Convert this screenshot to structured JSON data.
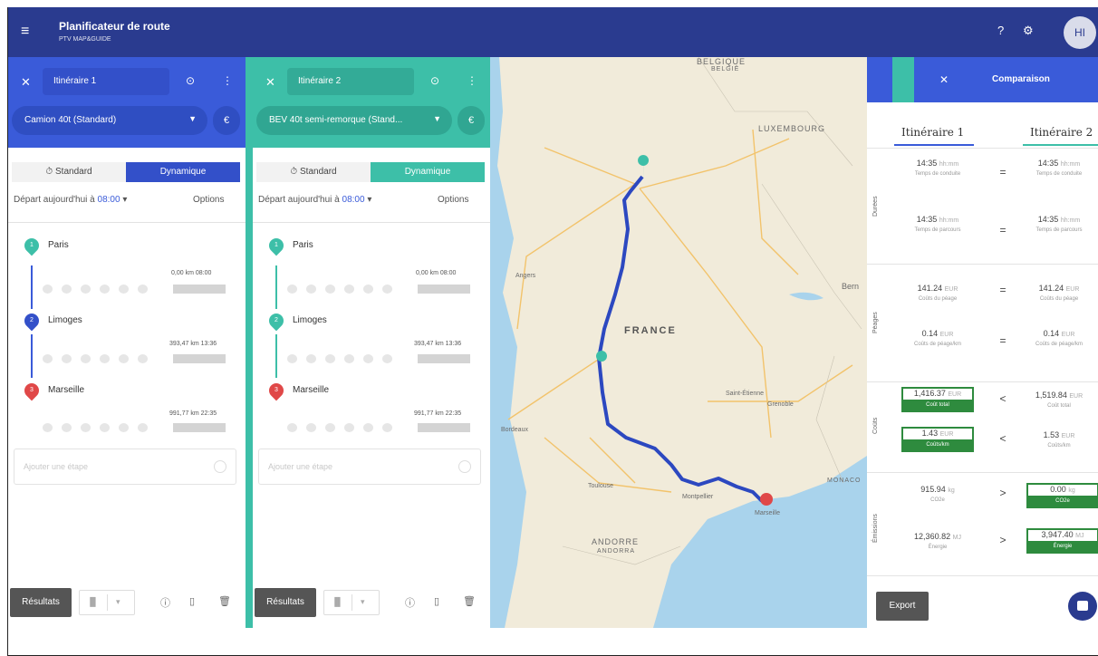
{
  "app": {
    "title": "Planificateur de route",
    "subtitle": "PTV MAP&GUIDE",
    "avatar": "HI",
    "help_icon": "?",
    "menu_icon": "≡"
  },
  "routes": [
    {
      "name": "Itinéraire 1",
      "vehicle": "Camion 40t (Standard)",
      "euro": "€",
      "mode_standard": "Standard",
      "mode_dynamic": "Dynamique",
      "depart_prefix": "Départ aujourd'hui à",
      "depart_time": "08:00",
      "options": "Options",
      "add_stage_placeholder": "Ajouter une étape",
      "results": "Résultats",
      "stops": [
        {
          "num": "1",
          "city": "Paris",
          "distance": "0,00 km",
          "time": "08:00"
        },
        {
          "num": "2",
          "city": "Limoges",
          "distance": "393,47 km",
          "time": "13:36"
        },
        {
          "num": "3",
          "city": "Marseille",
          "distance": "991,77 km",
          "time": "22:35"
        }
      ]
    },
    {
      "name": "Itinéraire 2",
      "vehicle": "BEV 40t semi-remorque (Stand...",
      "euro": "€",
      "mode_standard": "Standard",
      "mode_dynamic": "Dynamique",
      "depart_prefix": "Départ aujourd'hui à",
      "depart_time": "08:00",
      "options": "Options",
      "add_stage_placeholder": "Ajouter une étape",
      "results": "Résultats",
      "stops": [
        {
          "num": "1",
          "city": "Paris",
          "distance": "0,00 km",
          "time": "08:00"
        },
        {
          "num": "2",
          "city": "Limoges",
          "distance": "393,47 km",
          "time": "13:36"
        },
        {
          "num": "3",
          "city": "Marseille",
          "distance": "991,77 km",
          "time": "22:35"
        }
      ]
    }
  ],
  "map": {
    "labels": {
      "belgique": "BELGIQUE",
      "belgie": "BELGIË",
      "luxembourg": "LUXEMBOURG",
      "france": "FRANCE",
      "andorre": "ANDORRE",
      "andorra": "ANDORRA",
      "monaco": "MONACO",
      "bern": "Bern",
      "montpellier": "Montpellier",
      "marseille": "Marseille",
      "toulouse": "Toulouse",
      "bordeaux": "Bordeaux",
      "angers": "Angers",
      "saint_etienne": "Saint-Étienne",
      "grenoble": "Grenoble"
    }
  },
  "comparison": {
    "title": "Comparaison",
    "col1": "Itinéraire 1",
    "col2": "Itinéraire 2",
    "export": "Export",
    "sections": {
      "durees": "Durées",
      "peages": "Péages",
      "couts": "Coûts",
      "emissions": "Émissions"
    },
    "rows": [
      {
        "v1": "14:35",
        "u1": "hh:mm",
        "d1": "Temps de conduite",
        "op": "=",
        "v2": "14:35",
        "u2": "hh:mm",
        "d2": "Temps de conduite"
      },
      {
        "v1": "14:35",
        "u1": "hh:mm",
        "d1": "Temps de parcours",
        "op": "=",
        "v2": "14:35",
        "u2": "hh:mm",
        "d2": "Temps de parcours"
      },
      {
        "v1": "141.24",
        "u1": "EUR",
        "d1": "Coûts du péage",
        "op": "=",
        "v2": "141.24",
        "u2": "EUR",
        "d2": "Coûts du péage"
      },
      {
        "v1": "0.14",
        "u1": "EUR",
        "d1": "Coûts de péage/km",
        "op": "=",
        "v2": "0.14",
        "u2": "EUR",
        "d2": "Coûts de péage/km"
      },
      {
        "v1": "1,416.37",
        "u1": "EUR",
        "d1": "Coût total",
        "op": "<",
        "v2": "1,519.84",
        "u2": "EUR",
        "d2": "Coût total"
      },
      {
        "v1": "1.43",
        "u1": "EUR",
        "d1": "Coûts/km",
        "op": "<",
        "v2": "1.53",
        "u2": "EUR",
        "d2": "Coûts/km"
      },
      {
        "v1": "915.94",
        "u1": "kg",
        "d1": "CO2e",
        "op": ">",
        "v2": "0.00",
        "u2": "kg",
        "d2": "CO2e"
      },
      {
        "v1": "12,360.82",
        "u1": "MJ",
        "d1": "Énergie",
        "op": ">",
        "v2": "3,947.40",
        "u2": "MJ",
        "d2": "Énergie"
      }
    ],
    "colors": {
      "better": "#2e8b3e"
    }
  },
  "colors": {
    "topbar": "#2a3b8f",
    "route1": "#3a5bd9",
    "route2": "#3dbfa8",
    "route_line": "#2c48c0",
    "marker_red": "#e04848"
  }
}
